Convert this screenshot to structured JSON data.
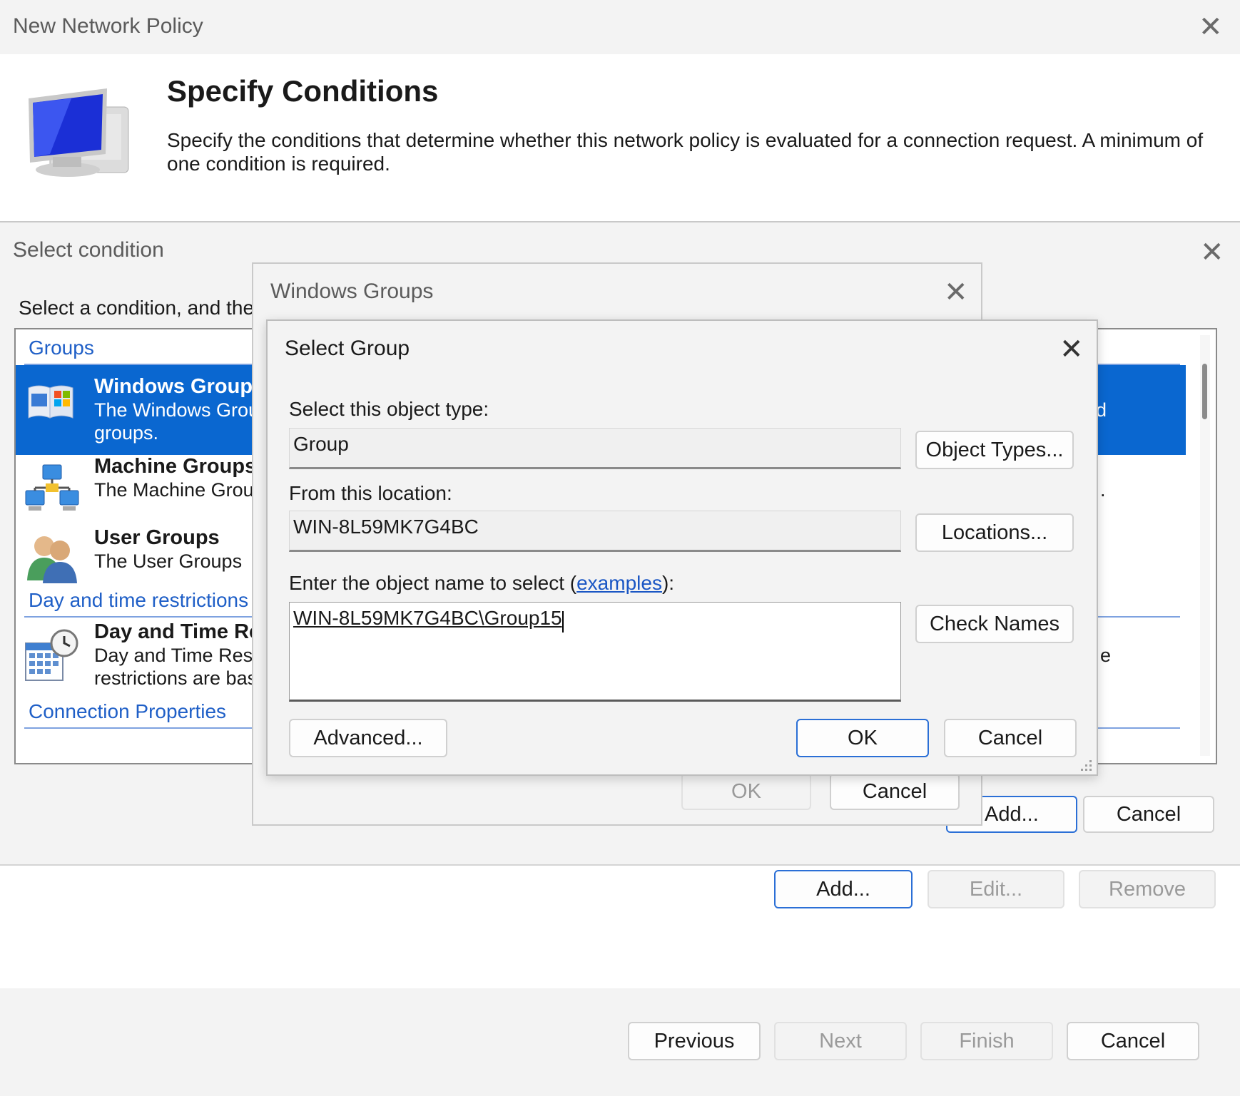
{
  "main": {
    "title": "New Network Policy",
    "header_title": "Specify Conditions",
    "header_desc": "Specify the conditions that determine whether this network policy is evaluated for a connection request. A minimum of one condition is required.",
    "buttons": {
      "add": "Add...",
      "edit": "Edit...",
      "remove": "Remove",
      "previous": "Previous",
      "next": "Next",
      "finish": "Finish",
      "cancel": "Cancel"
    }
  },
  "select_condition": {
    "title": "Select condition",
    "instruction": "Select a condition, and then",
    "sections": {
      "groups": "Groups",
      "day_time": "Day and time restrictions",
      "connection": "Connection Properties"
    },
    "items": {
      "windows_groups": {
        "title": "Windows Groups",
        "desc1": "The Windows Groups",
        "desc2": "groups."
      },
      "machine_groups": {
        "title": "Machine Groups",
        "desc1": "The Machine Groups"
      },
      "user_groups": {
        "title": "User Groups",
        "desc1": "The User Groups"
      },
      "day_time": {
        "title": "Day and Time Restrictions",
        "desc1": "Day and Time Restrictions",
        "desc2": "restrictions are based"
      }
    },
    "partial_right": {
      "a": "d",
      "b": ".",
      "c": "e"
    },
    "buttons": {
      "add": "Add...",
      "cancel": "Cancel"
    }
  },
  "windows_groups_dialog": {
    "title": "Windows Groups",
    "buttons": {
      "ok": "OK",
      "cancel": "Cancel"
    }
  },
  "select_group": {
    "title": "Select Group",
    "object_type_label": "Select this object type:",
    "object_type_value": "Group",
    "object_types_button": "Object Types...",
    "location_label": "From this location:",
    "location_value": "WIN-8L59MK7G4BC",
    "locations_button": "Locations...",
    "enter_label_pre": "Enter the object name to select (",
    "examples_link": "examples",
    "enter_label_post": "):",
    "object_name_value": "WIN-8L59MK7G4BC\\Group15",
    "check_names_button": "Check Names",
    "advanced_button": "Advanced...",
    "ok_button": "OK",
    "cancel_button": "Cancel"
  },
  "icons": {
    "close": "close-icon",
    "network_computer": "network-computer-icon",
    "windows_groups": "windows-groups-icon",
    "machine_groups": "machine-groups-icon",
    "user_groups": "user-groups-icon",
    "calendar_clock": "calendar-clock-icon",
    "resize_grip": "resize-grip-icon"
  },
  "colors": {
    "selection": "#0a67d0",
    "link": "#1f5fc7",
    "primary_border": "#2b6fd6"
  }
}
